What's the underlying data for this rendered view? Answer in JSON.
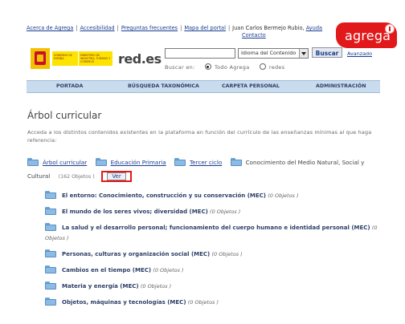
{
  "top_links": {
    "items": [
      "Acerca de Agrega",
      "Accesibilidad",
      "Preguntas frecuentes",
      "Mapa del portal",
      "Juan Carlos Bermejo Rubio",
      "Ayuda",
      "Contacto"
    ],
    "separator": "|"
  },
  "logo": {
    "text": "agrega"
  },
  "gov_logo": {
    "label1": "GOBIERNO DE ESPAÑA",
    "label2": "MINISTERIO DE INDUSTRIA, TURISMO Y COMERCIO",
    "redes": "red.es"
  },
  "search": {
    "input_value": "",
    "language_selected": "Idioma del Contenido",
    "button_label": "Buscar",
    "advanced_label": "Avanzado",
    "search_in_label": "Buscar en:",
    "option_all": "Todo Agrega",
    "option_nets": "redes",
    "selected_option": "Todo Agrega"
  },
  "nav": {
    "items": [
      "PORTADA",
      "BÚSQUEDA TAXONÓMICA",
      "CARPETA PERSONAL",
      "ADMINISTRACIÓN"
    ]
  },
  "page": {
    "title": "Árbol curricular",
    "intro": "Acceda a los distintos contenidos existentes en la plataforma en función del currículo de las enseñanzas mínimas al que haga referencia:"
  },
  "breadcrumb": {
    "items": [
      "Árbol curricular",
      "Educación Primaria",
      "Tercer ciclo"
    ],
    "current_line1": "Conocimiento del Medio Natural, Social y",
    "current_line2": "Cultural",
    "count": "(162 Objetos )",
    "view_button": "Ver"
  },
  "tree": {
    "items": [
      {
        "name": "El entorno: Conocimiento, construcción y su conservación (MEC)",
        "count": "(0 Objetos )"
      },
      {
        "name": "El mundo de los seres vivos; diversidad (MEC)",
        "count": "(0 Objetos )"
      },
      {
        "name": "La salud y el desarrollo personal; funcionamiento del cuerpo humano e identidad personal (MEC)",
        "count": "(0 Objetos )"
      },
      {
        "name": "Personas, culturas y organización social (MEC)",
        "count": "(0 Objetos )"
      },
      {
        "name": "Cambios en el tiempo (MEC)",
        "count": "(0 Objetos )"
      },
      {
        "name": "Materia y energía (MEC)",
        "count": "(0 Objetos )"
      },
      {
        "name": "Objetos, máquinas y tecnologías (MEC)",
        "count": "(0 Objetos )"
      }
    ]
  },
  "colors": {
    "brand_red": "#e2191b",
    "nav_bg": "#c9dcee",
    "link_blue": "#1a3d8f"
  }
}
